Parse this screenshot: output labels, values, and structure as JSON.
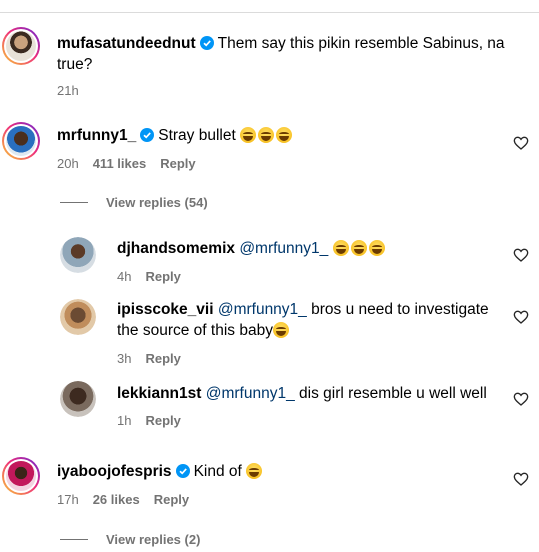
{
  "comments": [
    {
      "username": "mufasatundeednut",
      "verified": true,
      "text_line1": "Them say this pikin resemble Sabinus, na",
      "text_line2": "true?",
      "time": "21h"
    },
    {
      "username": "mrfunny1_",
      "verified": true,
      "text": "Stray bullet",
      "time": "20h",
      "likes": "411 likes",
      "reply": "Reply",
      "view_replies": "View replies (54)"
    },
    {
      "username": "iyaboojofespris",
      "verified": true,
      "text": "Kind of",
      "time": "17h",
      "likes": "26 likes",
      "reply": "Reply",
      "view_replies": "View replies (2)"
    }
  ],
  "replies": [
    {
      "username": "djhandsomemix",
      "mention": "@mrfunny1_",
      "text": "",
      "time": "4h",
      "reply": "Reply"
    },
    {
      "username": "ipisscoke_vii",
      "mention": "@mrfunny1_",
      "text_line1": "bros u need to investigate",
      "text_line2": "the source of this baby",
      "time": "3h",
      "reply": "Reply"
    },
    {
      "username": "lekkiann1st",
      "mention": "@mrfunny1_",
      "text": "dis girl resemble u well well",
      "time": "1h",
      "reply": "Reply"
    }
  ],
  "icons": {
    "verified_color": "#0095f6",
    "heart": "heart-outline-icon"
  }
}
